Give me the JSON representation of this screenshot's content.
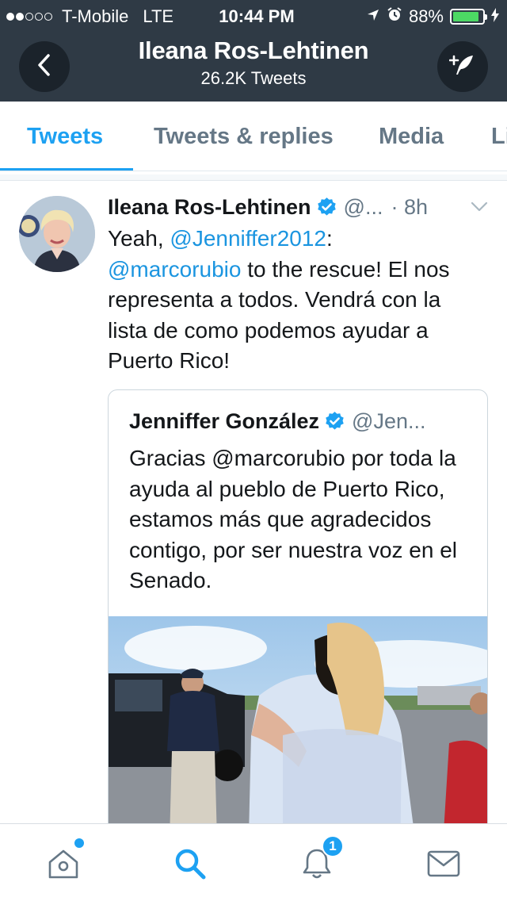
{
  "status_bar": {
    "carrier": "T-Mobile",
    "network": "LTE",
    "time": "10:44 PM",
    "battery": "88%",
    "battery_level": 0.88,
    "signal_bars_filled": 2,
    "signal_bars_total": 5
  },
  "header": {
    "title": "Ileana Ros-Lehtinen",
    "subtitle": "26.2K Tweets",
    "back_icon": "chevron-left-icon",
    "compose_icon": "compose-tweet-icon"
  },
  "tabs": [
    {
      "label": "Tweets",
      "active": true
    },
    {
      "label": "Tweets & replies",
      "active": false
    },
    {
      "label": "Media",
      "active": false
    },
    {
      "label": "Likes",
      "active": false
    }
  ],
  "tweet": {
    "author_name": "Ileana Ros-Lehtinen",
    "handle": "@...",
    "time": "· 8h",
    "verified": true,
    "text_prefix": "Yeah, ",
    "mention_1": "@Jenniffer2012",
    "text_mid": ": ",
    "mention_2": "@marcorubio",
    "text_rest": " to the rescue! El nos representa a todos. Vendrá con la lista de como podemos ayudar a Puerto Rico!",
    "quoted": {
      "author_name": "Jenniffer González",
      "handle": "@Jen...",
      "verified": true,
      "text": "Gracias @marcorubio por toda la ayuda al pueblo de Puerto Rico, estamos más que agradecidos contigo, por ser nuestra voz en el Senado."
    }
  },
  "bottom_nav": [
    {
      "name": "home",
      "icon": "home-icon",
      "active": false,
      "has_new": true
    },
    {
      "name": "search",
      "icon": "search-icon",
      "active": true
    },
    {
      "name": "notifications",
      "icon": "bell-icon",
      "active": false,
      "badge": "1"
    },
    {
      "name": "messages",
      "icon": "envelope-icon",
      "active": false
    }
  ],
  "colors": {
    "header_bg": "#2f3a45",
    "accent": "#1da1f2",
    "link": "#1b95e0",
    "muted": "#657786",
    "battery": "#4cd964"
  }
}
